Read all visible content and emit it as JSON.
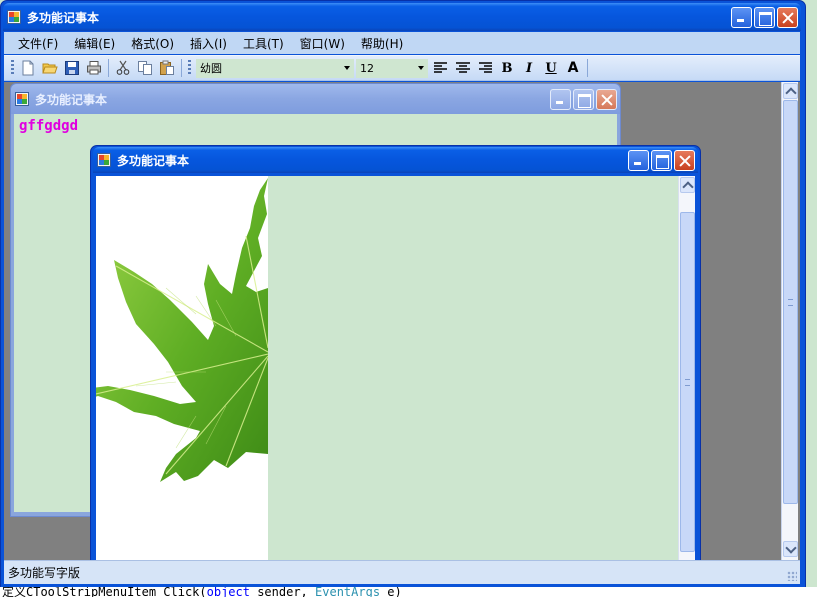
{
  "main_window": {
    "title": "多功能记事本",
    "menu": [
      "文件(F)",
      "编辑(E)",
      "格式(O)",
      "插入(I)",
      "工具(T)",
      "窗口(W)",
      "帮助(H)"
    ],
    "toolbar": {
      "icons": [
        "new-file-icon",
        "open-folder-icon",
        "save-icon",
        "print-icon",
        "cut-icon",
        "copy-icon",
        "paste-icon"
      ],
      "font_name": "幼圆",
      "font_size": "12",
      "format_buttons": {
        "align_left": "align-left-icon",
        "align_center": "align-center-icon",
        "align_right": "align-right-icon",
        "bold": "B",
        "italic": "I",
        "underline": "U",
        "font_color": "A"
      }
    },
    "status": "多功能写字版"
  },
  "child_windows": [
    {
      "title": "多功能记事本",
      "text": "gffgdgd",
      "text_color": "#e000e0"
    },
    {
      "title": "多功能记事本",
      "image": "green-maple-leaf"
    }
  ],
  "background_code": {
    "prefix": "定义CToolStripMenuItem_Click(",
    "kw": "object",
    "mid": " sender, ",
    "ty": "EventArgs",
    "suffix": " e)"
  },
  "colors": {
    "titlebar_blue": "#0a5fe6",
    "editor_background": "#cde6cf",
    "mdi_background": "#808080"
  }
}
